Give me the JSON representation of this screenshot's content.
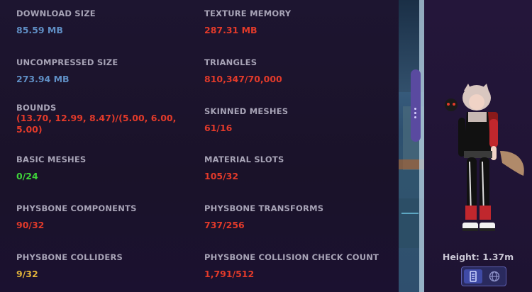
{
  "stats": [
    {
      "label": "DOWNLOAD SIZE",
      "value": "85.59 MB",
      "color": "blue"
    },
    {
      "label": "TEXTURE MEMORY",
      "value": "287.31 MB",
      "color": "red"
    },
    {
      "label": "UNCOMPRESSED SIZE",
      "value": "273.94 MB",
      "color": "blue"
    },
    {
      "label": "TRIANGLES",
      "value": "810,347/70,000",
      "color": "red"
    },
    {
      "label": "BOUNDS",
      "value": "(13.70, 12.99, 8.47)/(5.00, 6.00, 5.00)",
      "color": "red"
    },
    {
      "label": "SKINNED MESHES",
      "value": "61/16",
      "color": "red"
    },
    {
      "label": "BASIC MESHES",
      "value": "0/24",
      "color": "green"
    },
    {
      "label": "MATERIAL SLOTS",
      "value": "105/32",
      "color": "red"
    },
    {
      "label": "PHYSBONE COMPONENTS",
      "value": "90/32",
      "color": "red"
    },
    {
      "label": "PHYSBONE TRANSFORMS",
      "value": "737/256",
      "color": "red"
    },
    {
      "label": "PHYSBONE COLLIDERS",
      "value": "9/32",
      "color": "yellow"
    },
    {
      "label": "PHYSBONE COLLISION CHECK COUNT",
      "value": "1,791/512",
      "color": "red"
    }
  ],
  "status_colors": {
    "blue": "#5f8ec4",
    "red": "#e23a2a",
    "green": "#3fd43a",
    "yellow": "#e2b43a"
  },
  "preview": {
    "height_text": "Height: 1.37m",
    "view_toggle": {
      "left_icon": "performance-icon",
      "right_icon": "globe-icon",
      "selected": "left"
    }
  }
}
